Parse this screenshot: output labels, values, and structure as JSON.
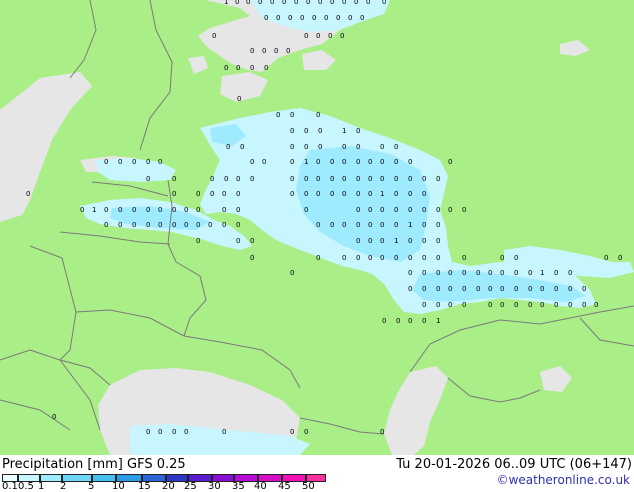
{
  "map": {
    "colors": {
      "land": "#aaee88",
      "sea": "#e6e6e6",
      "precip_light": "#c8f6ff",
      "precip_mid": "#9eeaff",
      "border": "#7a7a7a"
    },
    "point_labels": [
      "0",
      "0.1",
      "1"
    ]
  },
  "legend": {
    "title": "Precipitation [mm]  GFS 0.25",
    "datetime": "Tu 20-01-2026 06..09 UTC (06+147)",
    "credit": "©weatheronline.co.uk",
    "scale_labels": [
      "0.1",
      "0.5",
      "1",
      "2",
      "5",
      "10",
      "15",
      "20",
      "25",
      "30",
      "35",
      "40",
      "45",
      "50"
    ],
    "scale_colors": [
      "#e8feff",
      "#c8f6ff",
      "#9eeaff",
      "#6ed6f6",
      "#46bef0",
      "#2a9ce6",
      "#2a64d6",
      "#2e36c4",
      "#5a1ed0",
      "#8a10d8",
      "#b40ed6",
      "#d60ec6",
      "#f010b4",
      "#f830a0"
    ]
  }
}
